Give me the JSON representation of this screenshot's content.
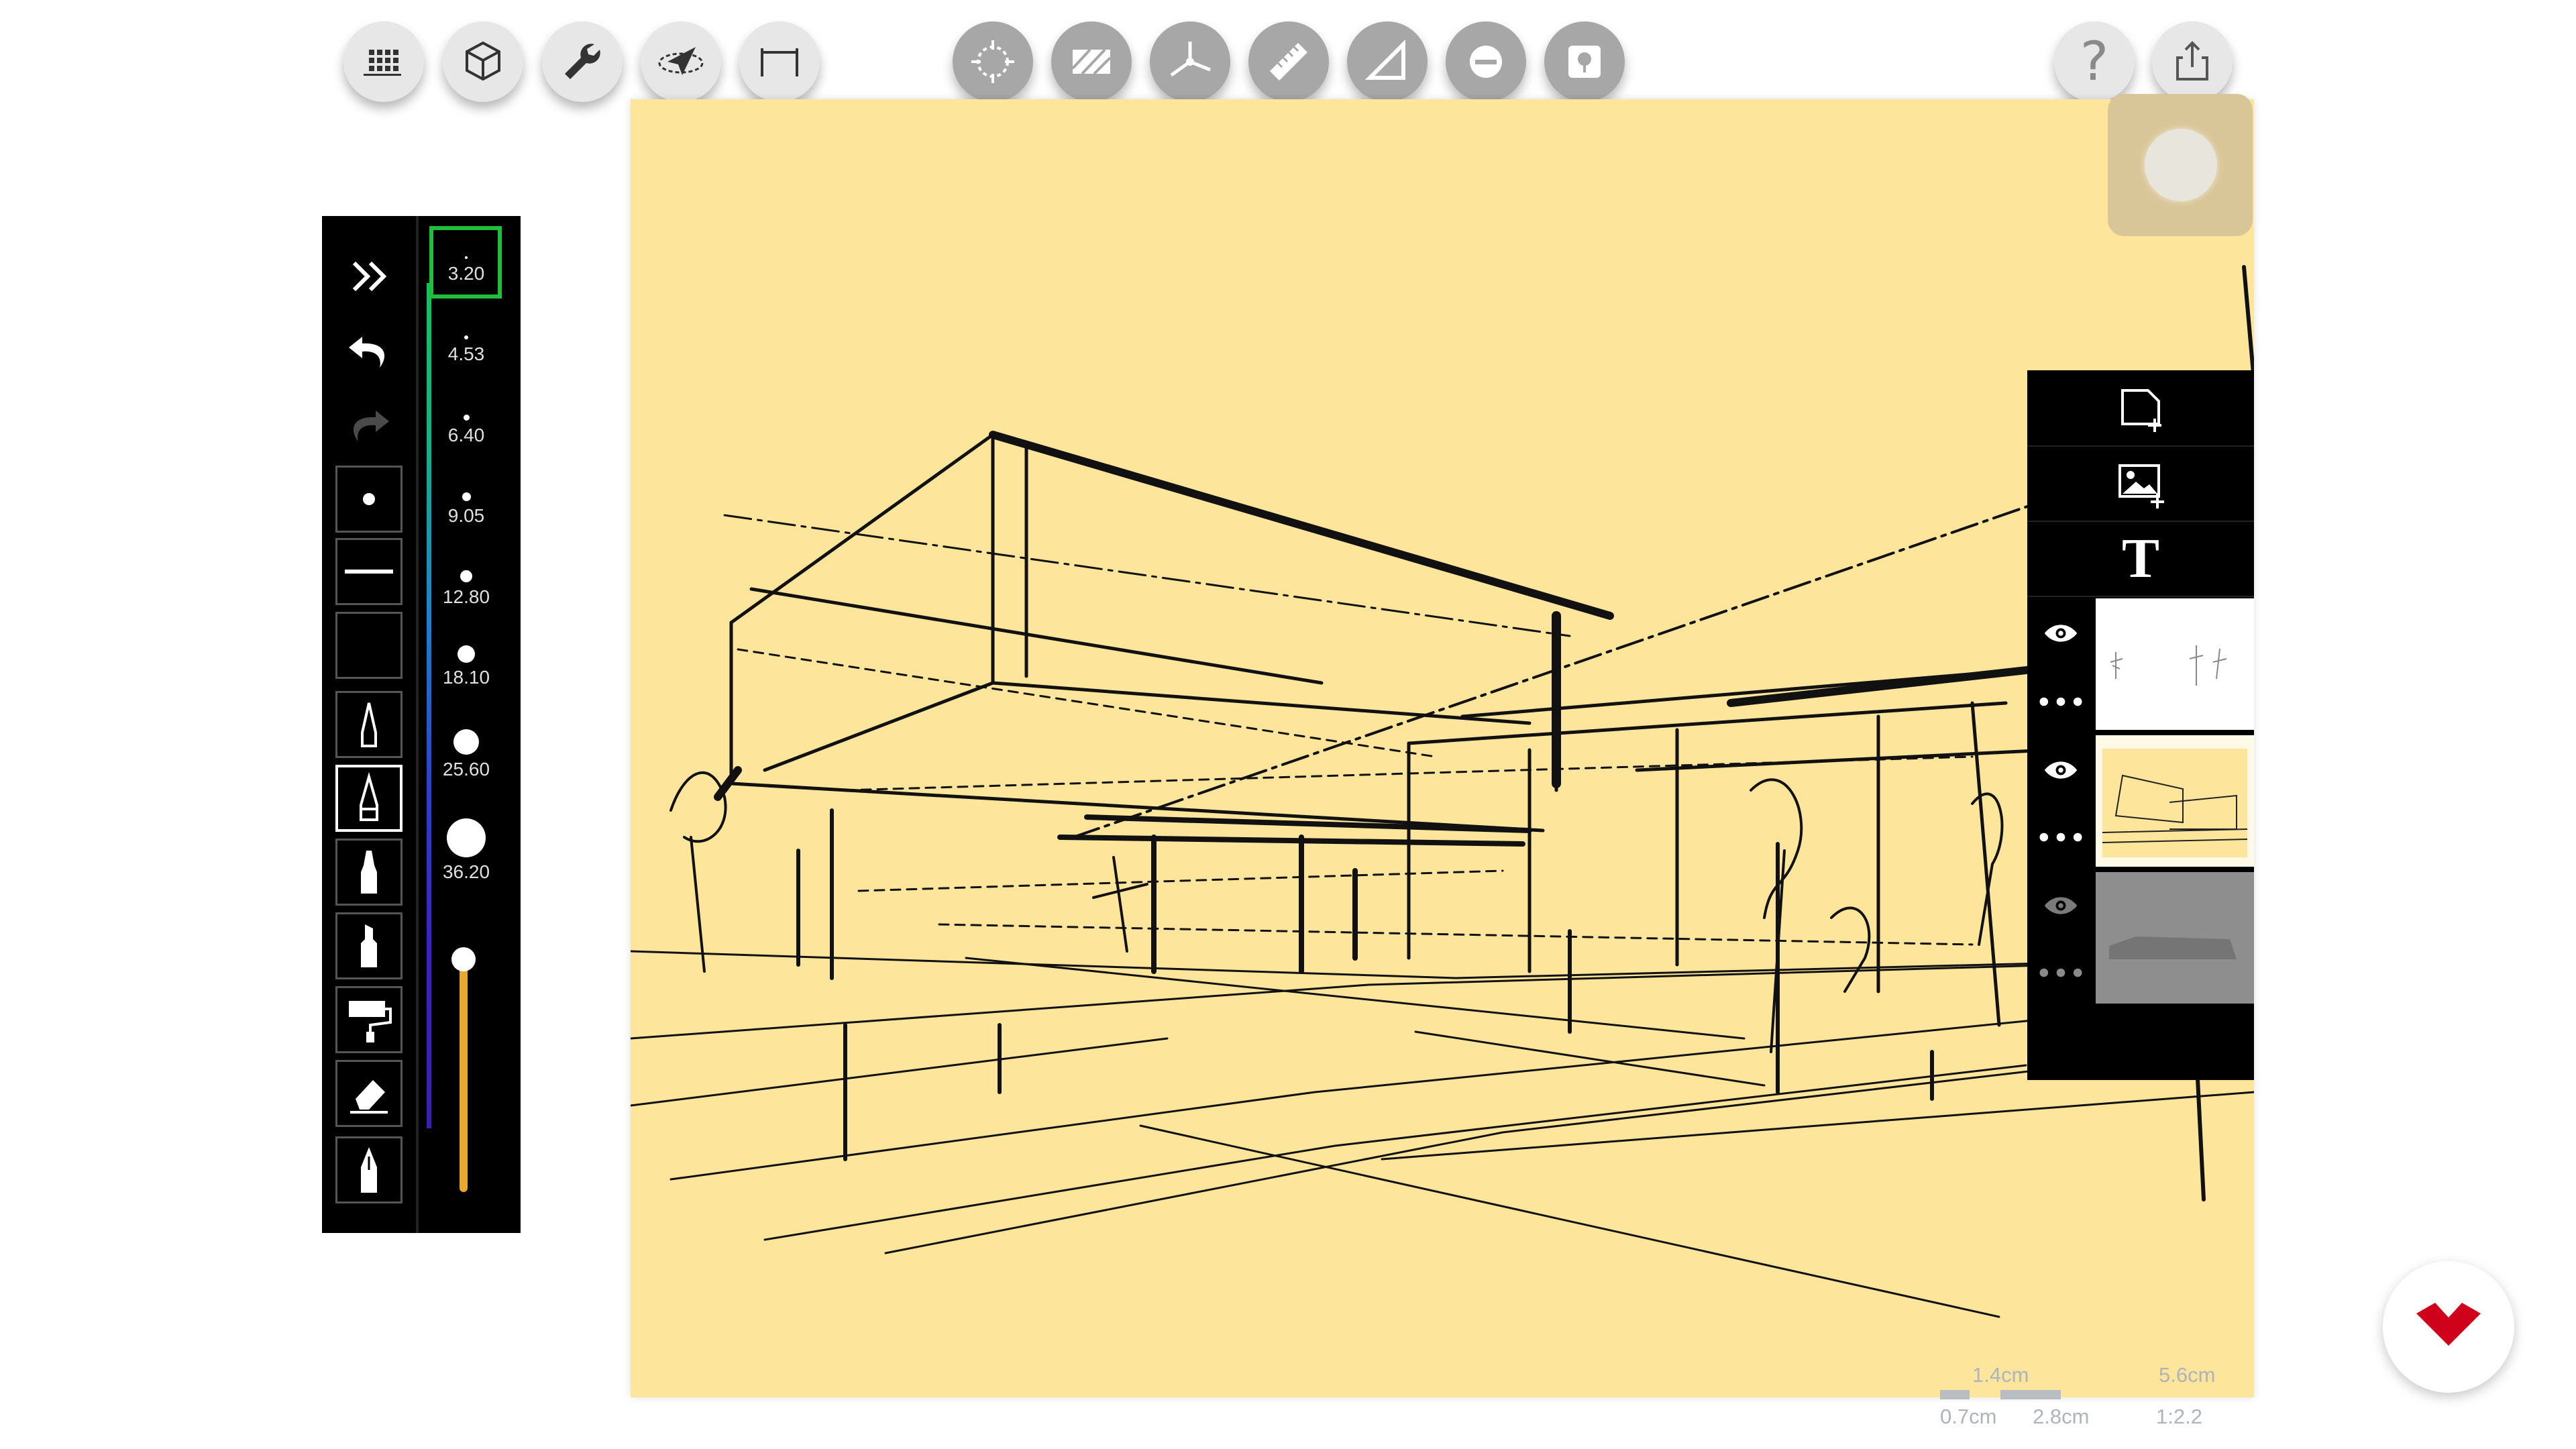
{
  "toolbar": {
    "left_buttons": [
      "grid-icon",
      "cube-icon",
      "wrench-icon",
      "lasso-arrow-icon",
      "dimension-icon"
    ],
    "center_buttons": [
      "transform-icon",
      "hatch-icon",
      "perspective-axes-icon",
      "ruler-icon",
      "set-square-icon",
      "circle-template-icon",
      "tree-stamp-icon"
    ],
    "right_buttons": [
      "help-icon",
      "share-icon"
    ],
    "help_label": "?"
  },
  "brush_sizes": [
    "3.20",
    "4.53",
    "6.40",
    "9.05",
    "12.80",
    "18.10",
    "25.60",
    "36.20"
  ],
  "selected_brush_size": "3.20",
  "opacity_slider": {
    "value": 1.0
  },
  "tools": [
    "collapse-icon",
    "undo-icon",
    "redo-icon",
    "dot-brush-icon",
    "line-brush-icon",
    "blank-brush-icon",
    "technical-pen-icon",
    "fine-pen-icon",
    "felt-pen-icon",
    "marker-icon",
    "paint-roller-icon",
    "eraser-icon",
    "ink-pen-icon"
  ],
  "layers_panel": {
    "actions": [
      "new-layer-icon",
      "add-image-icon",
      "add-text-icon"
    ],
    "text_icon_glyph": "T",
    "layers": [
      {
        "name": "trees-layer",
        "visible": true
      },
      {
        "name": "sketch-layer",
        "visible": true
      },
      {
        "name": "background-layer",
        "visible": true
      }
    ]
  },
  "scale_bar": {
    "top_labels": [
      "1.4cm",
      "5.6cm"
    ],
    "bottom_labels": [
      "0.7cm",
      "2.8cm",
      "1:2.2"
    ]
  },
  "colors": {
    "paper": "#fde59c",
    "accent_red": "#d0021b",
    "selected_size_border": "#1fbf3c"
  }
}
